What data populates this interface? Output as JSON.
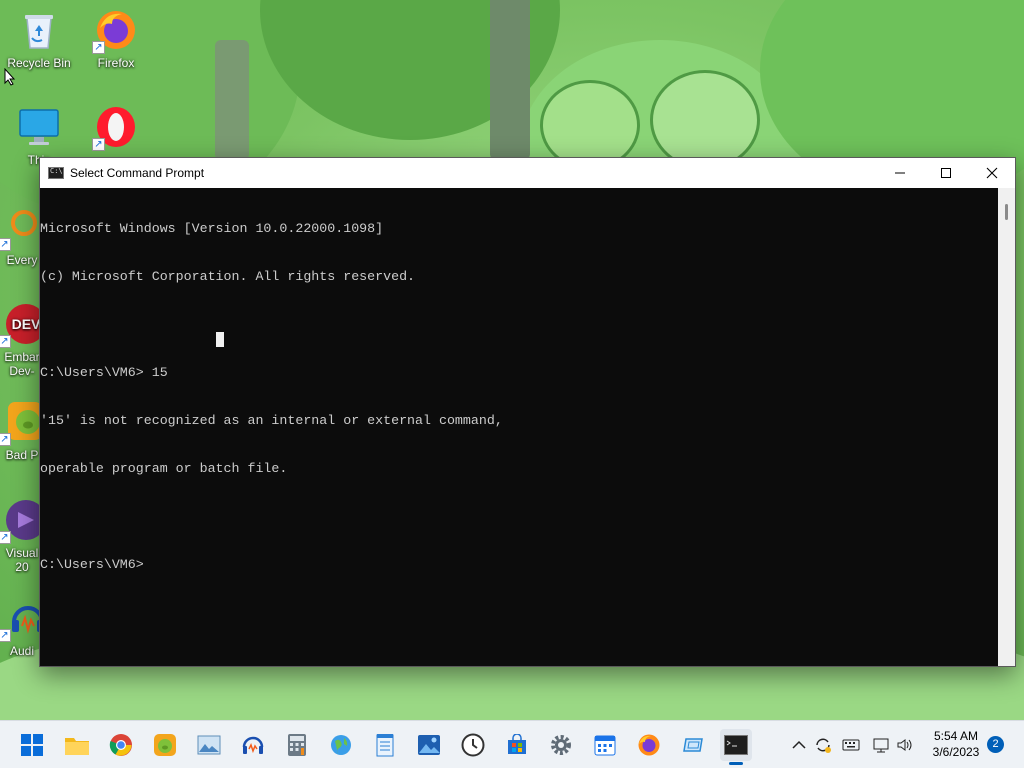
{
  "desktop": {
    "icons": [
      {
        "label": "Recycle Bin"
      },
      {
        "label": "Firefox"
      },
      {
        "label": "This"
      },
      {
        "label": "Every"
      },
      {
        "label": "Embar"
      },
      {
        "label": "Dev-"
      },
      {
        "label": "Bad P"
      },
      {
        "label": "Visual"
      },
      {
        "label": "20"
      },
      {
        "label": "Audi"
      }
    ]
  },
  "window": {
    "title": "Select Command Prompt",
    "console_lines": [
      "Microsoft Windows [Version 10.0.22000.1098]",
      "(c) Microsoft Corporation. All rights reserved.",
      "",
      "C:\\Users\\VM6> 15",
      "'15' is not recognized as an internal or external command,",
      "operable program or batch file.",
      "",
      "C:\\Users\\VM6>"
    ]
  },
  "taskbar": {
    "time": "5:54 AM",
    "date": "3/6/2023",
    "notification_count": "2"
  },
  "colors": {
    "console_bg": "#0c0c0c",
    "console_fg": "#cccccc",
    "taskbar_bg": "#eef2f6",
    "accent": "#005fb8"
  }
}
